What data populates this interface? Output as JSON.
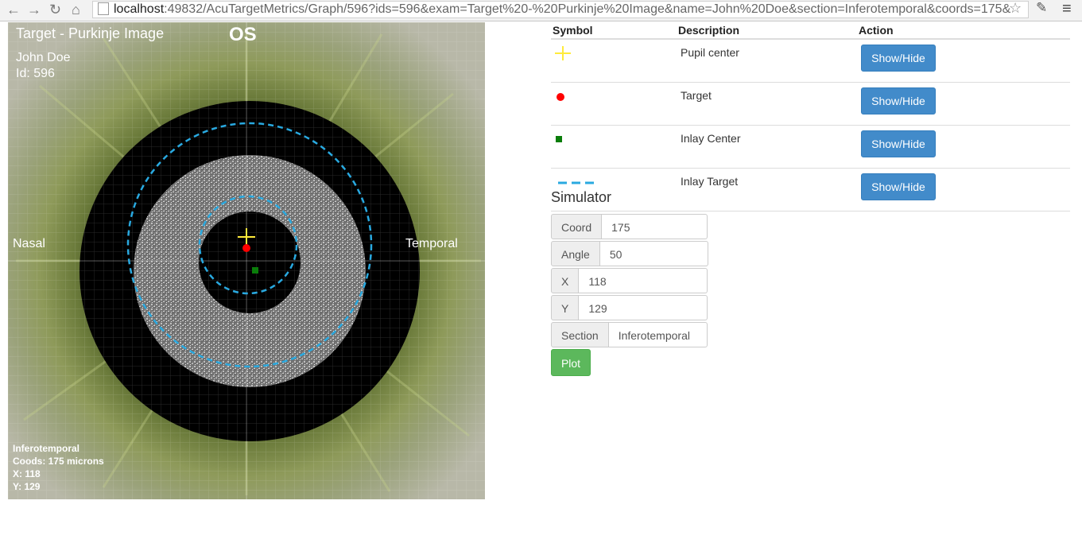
{
  "browser": {
    "url_host": "localhost",
    "url_path": ":49832/AcuTargetMetrics/Graph/596?ids=596&exam=Target%20-%20Purkinje%20Image&name=John%20Doe&section=Inferotemporal&coords=175&"
  },
  "image": {
    "title": "Target - Purkinje Image",
    "eye": "OS",
    "patient_name": "John Doe",
    "patient_id": "Id: 596",
    "nasal_label": "Nasal",
    "temporal_label": "Temporal",
    "info_section": "Inferotemporal",
    "info_coords": "Coods: 175 microns",
    "info_x": "X: 118",
    "info_y": "Y: 129"
  },
  "legend": {
    "headers": {
      "symbol": "Symbol",
      "description": "Description",
      "action": "Action"
    },
    "rows": [
      {
        "symbol": "yellow-cross-icon",
        "description": "Pupil center",
        "action": "Show/Hide",
        "color": "#ffeb3b"
      },
      {
        "symbol": "red-dot-icon",
        "description": "Target",
        "action": "Show/Hide",
        "color": "#ff0000"
      },
      {
        "symbol": "green-square-icon",
        "description": "Inlay Center",
        "action": "Show/Hide",
        "color": "#0a7d0a"
      },
      {
        "symbol": "dashed-line-icon",
        "description": "Inlay Target",
        "action": "Show/Hide",
        "color": "#29a9e0"
      }
    ]
  },
  "simulator": {
    "title": "Simulator",
    "fields": {
      "coord": {
        "label": "Coord",
        "value": "175"
      },
      "angle": {
        "label": "Angle",
        "value": "50"
      },
      "x": {
        "label": "X",
        "value": "118"
      },
      "y": {
        "label": "Y",
        "value": "129"
      },
      "section": {
        "label": "Section",
        "value": "Inferotemporal"
      }
    },
    "plot_label": "Plot"
  }
}
